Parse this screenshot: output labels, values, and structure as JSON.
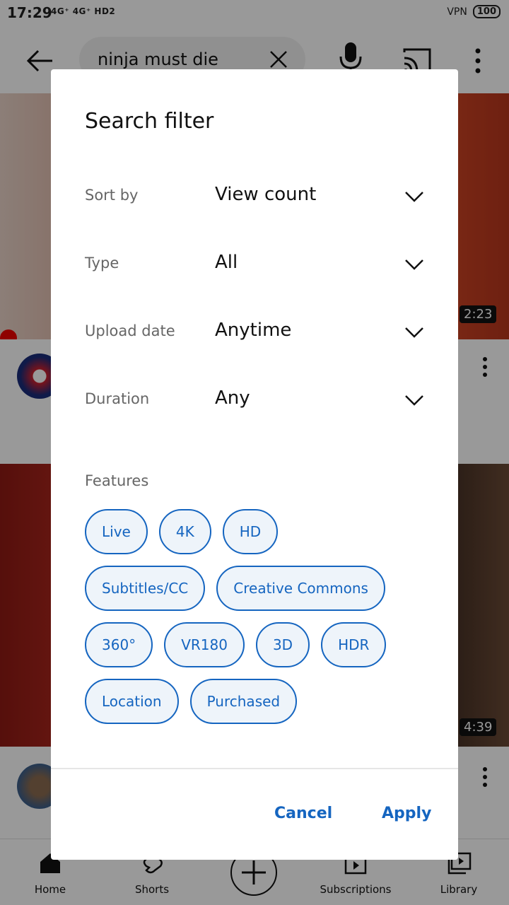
{
  "status_bar": {
    "time": "17:29",
    "network": "4G⁺ 4G⁺ HD2",
    "vpn": "VPN",
    "battery": "100"
  },
  "search": {
    "query": "ninja must die"
  },
  "videos": [
    {
      "duration": "2:23"
    },
    {
      "duration": "4:39"
    }
  ],
  "bottom_nav": {
    "items": [
      {
        "label": "Home",
        "icon": "home-icon"
      },
      {
        "label": "Shorts",
        "icon": "shorts-icon"
      },
      {
        "label": "",
        "icon": "create-icon"
      },
      {
        "label": "Subscriptions",
        "icon": "subscriptions-icon"
      },
      {
        "label": "Library",
        "icon": "library-icon"
      }
    ]
  },
  "dialog": {
    "title": "Search filter",
    "filters": [
      {
        "label": "Sort by",
        "value": "View count"
      },
      {
        "label": "Type",
        "value": "All"
      },
      {
        "label": "Upload date",
        "value": "Anytime"
      },
      {
        "label": "Duration",
        "value": "Any"
      }
    ],
    "features_label": "Features",
    "features": [
      [
        "Live",
        "4K",
        "HD"
      ],
      [
        "Subtitles/CC",
        "Creative Commons"
      ],
      [
        "360°",
        "VR180",
        "3D",
        "HDR"
      ],
      [
        "Location",
        "Purchased"
      ]
    ],
    "cancel": "Cancel",
    "apply": "Apply",
    "accent_color": "#1565c0"
  }
}
